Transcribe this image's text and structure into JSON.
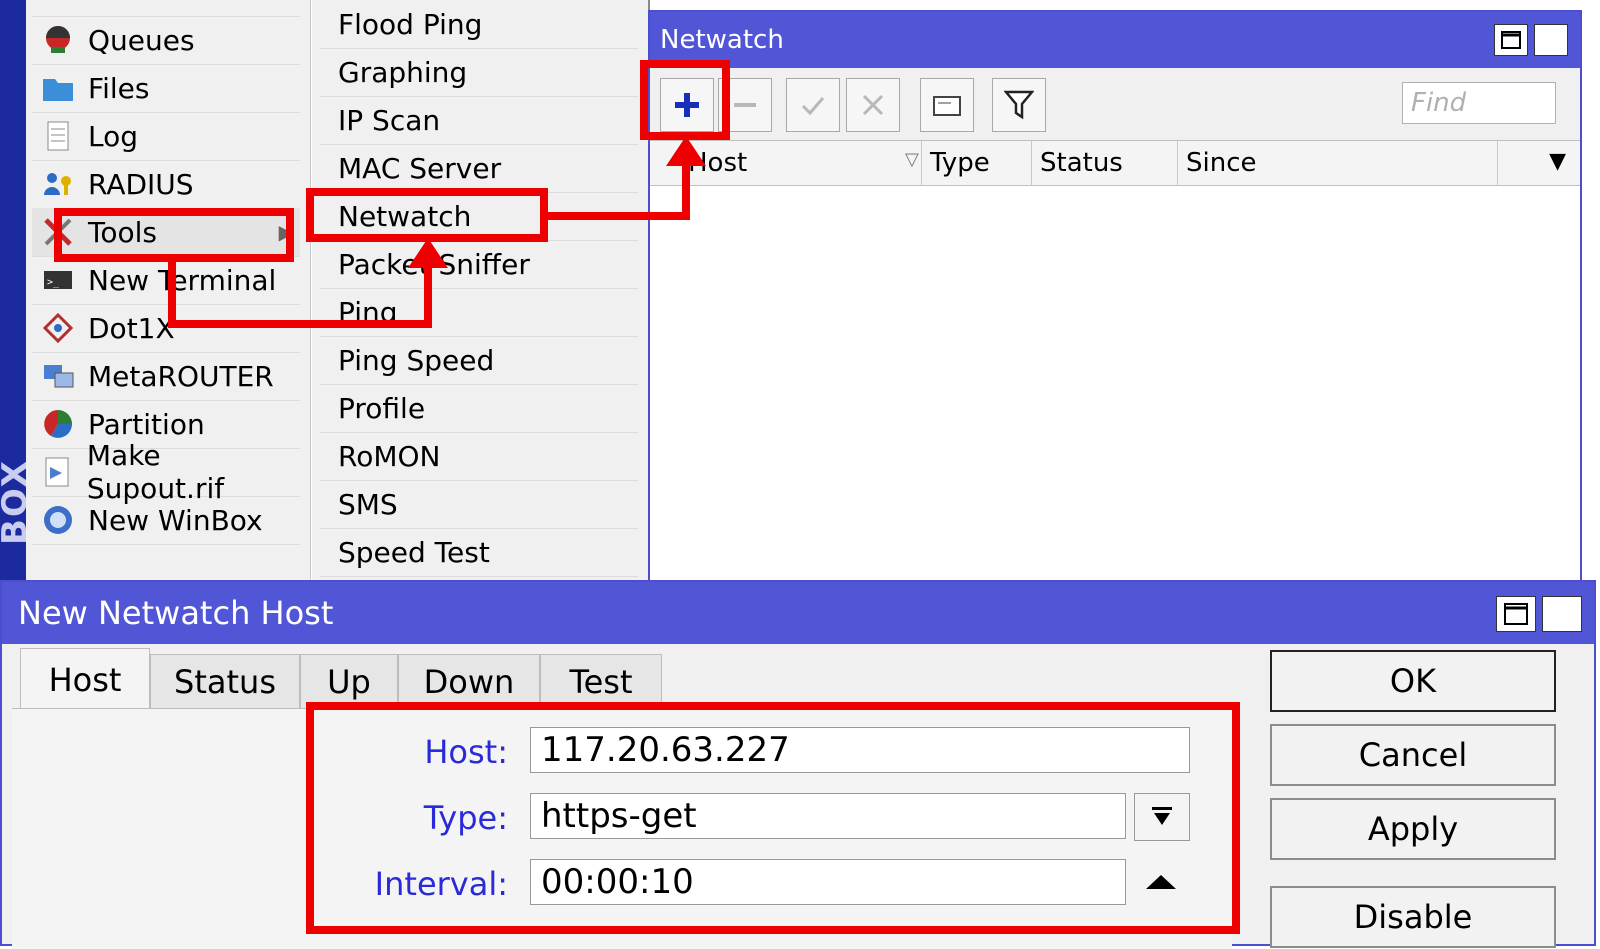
{
  "brand": {
    "label": "BOX"
  },
  "main_menu": {
    "items": [
      {
        "label": "Queues",
        "icon": "queues-icon"
      },
      {
        "label": "Files",
        "icon": "folder-icon"
      },
      {
        "label": "Log",
        "icon": "log-icon"
      },
      {
        "label": "RADIUS",
        "icon": "radius-icon"
      },
      {
        "label": "Tools",
        "icon": "tools-icon"
      },
      {
        "label": "New Terminal",
        "icon": "terminal-icon"
      },
      {
        "label": "Dot1X",
        "icon": "dot1x-icon"
      },
      {
        "label": "MetaROUTER",
        "icon": "metarouter-icon"
      },
      {
        "label": "Partition",
        "icon": "partition-icon"
      },
      {
        "label": "Make Supout.rif",
        "icon": "supout-icon"
      },
      {
        "label": "New WinBox",
        "icon": "winbox-icon"
      }
    ]
  },
  "tools_menu": {
    "items": [
      {
        "label": "Flood Ping"
      },
      {
        "label": "Graphing"
      },
      {
        "label": "IP Scan"
      },
      {
        "label": "MAC Server"
      },
      {
        "label": "Netwatch"
      },
      {
        "label": "Packet Sniffer"
      },
      {
        "label": "Ping"
      },
      {
        "label": "Ping Speed"
      },
      {
        "label": "Profile"
      },
      {
        "label": "RoMON"
      },
      {
        "label": "SMS"
      },
      {
        "label": "Speed Test"
      }
    ]
  },
  "netwatch_window": {
    "title": "Netwatch",
    "find_placeholder": "Find",
    "columns": [
      {
        "label": "Host"
      },
      {
        "label": "Type"
      },
      {
        "label": "Status"
      },
      {
        "label": "Since"
      }
    ]
  },
  "dialog": {
    "title": "New Netwatch Host",
    "tabs": [
      {
        "label": "Host"
      },
      {
        "label": "Status"
      },
      {
        "label": "Up"
      },
      {
        "label": "Down"
      },
      {
        "label": "Test"
      }
    ],
    "fields": {
      "host": {
        "label": "Host:",
        "value": "117.20.63.227"
      },
      "type": {
        "label": "Type:",
        "value": "https-get"
      },
      "interval": {
        "label": "Interval:",
        "value": "00:00:10"
      }
    },
    "buttons": {
      "ok": "OK",
      "cancel": "Cancel",
      "apply": "Apply",
      "disable": "Disable"
    }
  },
  "colors": {
    "titlebar": "#5156d6",
    "highlight": "#ee0000",
    "field_label": "#2a2ad8"
  }
}
